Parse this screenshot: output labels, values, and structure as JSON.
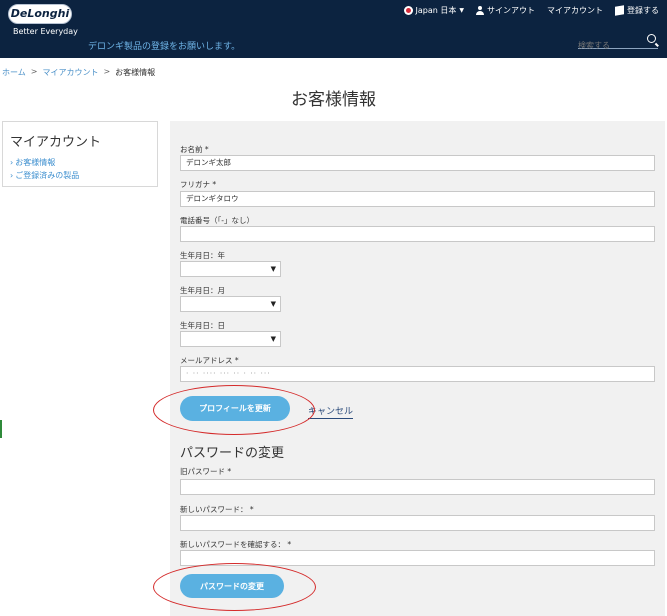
{
  "header": {
    "logo": "DeLonghi",
    "tagline": "Better Everyday",
    "promo": "デロンギ製品の登録をお願いします。",
    "nav": {
      "region": "Japan 日本",
      "signout": "サインアウト",
      "account": "マイアカウント",
      "register": "登録する"
    },
    "search_placeholder": "検索する"
  },
  "breadcrumb": {
    "items": [
      "ホーム",
      "マイアカウント",
      "お客様情報"
    ],
    "separator": ">"
  },
  "page_title": "お客様情報",
  "sidebar": {
    "title": "マイアカウント",
    "items": [
      "お客様情報",
      "ご登録済みの製品"
    ]
  },
  "form": {
    "name_label": "お名前 *",
    "name_value": "デロンギ太郎",
    "kana_label": "フリガナ *",
    "kana_value": "デロンギタロウ",
    "phone_label": "電話番号（「-」なし）",
    "phone_value": "",
    "birth_year_label": "生年月日：年",
    "birth_month_label": "生年月日：月",
    "birth_day_label": "生年月日：日",
    "email_label": "メールアドレス *",
    "email_value": "· ·· ···· ··· ·· · ·· ···",
    "update_button": "プロフィールを更新",
    "cancel_link": "キャンセル"
  },
  "password": {
    "section_title": "パスワードの変更",
    "old_label": "旧パスワード *",
    "new_label": "新しいパスワード： *",
    "confirm_label": "新しいパスワードを確認する： *",
    "change_button": "パスワードの変更"
  },
  "colors": {
    "header_bg": "#0c2340",
    "link": "#3d8fcf",
    "button": "#5ab1e1",
    "annotation": "#d42a2a"
  }
}
